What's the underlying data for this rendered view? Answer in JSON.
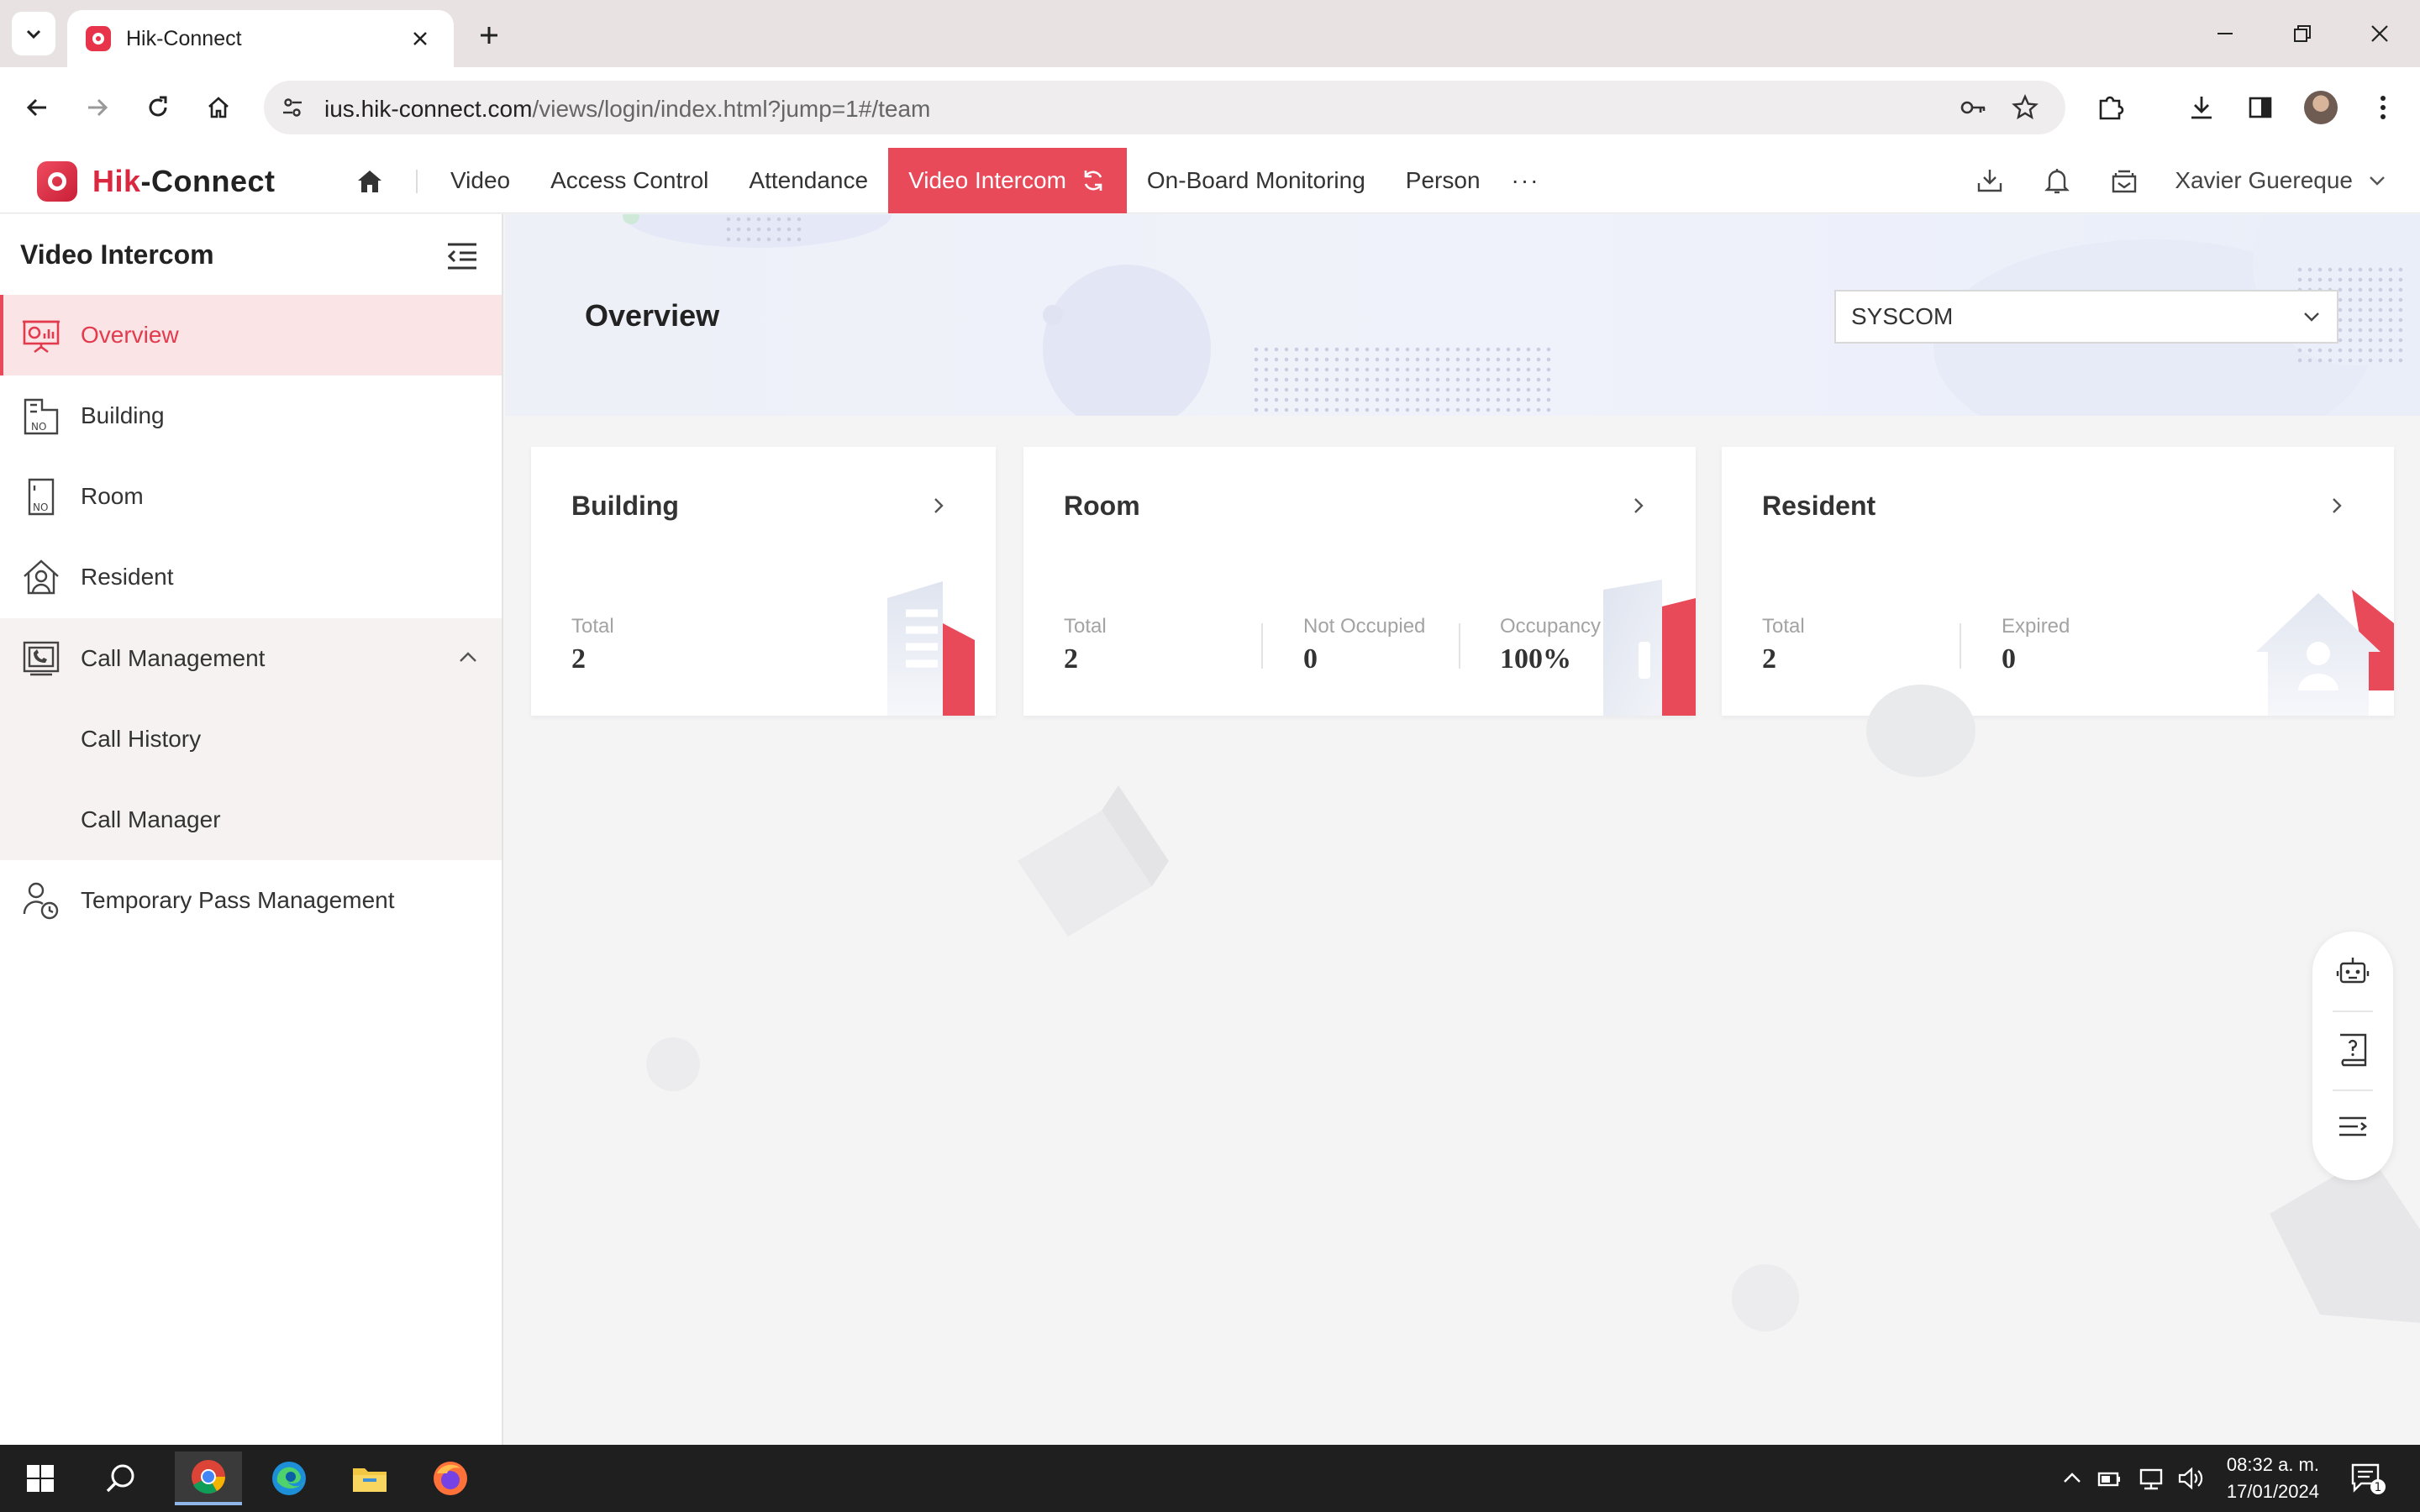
{
  "browser": {
    "tab_title": "Hik-Connect",
    "url_host": "ius.hik-connect.com",
    "url_path": "/views/login/index.html?jump=1#/team"
  },
  "app": {
    "logo_brand": "Hik",
    "logo_rest": "-Connect",
    "nav": [
      "Video",
      "Access Control",
      "Attendance",
      "Video Intercom",
      "On-Board Monitoring",
      "Person"
    ],
    "nav_more": "···",
    "user_name": "Xavier Guereque"
  },
  "sidebar": {
    "title": "Video Intercom",
    "items": {
      "overview": "Overview",
      "building": "Building",
      "room": "Room",
      "resident": "Resident",
      "call_management": "Call Management",
      "call_history": "Call History",
      "call_manager": "Call Manager",
      "temporary_pass": "Temporary Pass Management"
    }
  },
  "main": {
    "title": "Overview",
    "site_selected": "SYSCOM",
    "cards": {
      "building": {
        "title": "Building",
        "total_label": "Total",
        "total": "2"
      },
      "room": {
        "title": "Room",
        "total_label": "Total",
        "total": "2",
        "not_occupied_label": "Not Occupied",
        "not_occupied": "0",
        "occupancy_label": "Occupancy Ra",
        "occupancy": "100%"
      },
      "resident": {
        "title": "Resident",
        "total_label": "Total",
        "total": "2",
        "expired_label": "Expired",
        "expired": "0"
      }
    }
  },
  "taskbar": {
    "time": "08:32 a. m.",
    "date": "17/01/2024",
    "notification_count": "1"
  },
  "colors": {
    "accent": "#e84a5a",
    "active_bg": "#fbe4e6",
    "taskbar": "#1f1f1f"
  }
}
